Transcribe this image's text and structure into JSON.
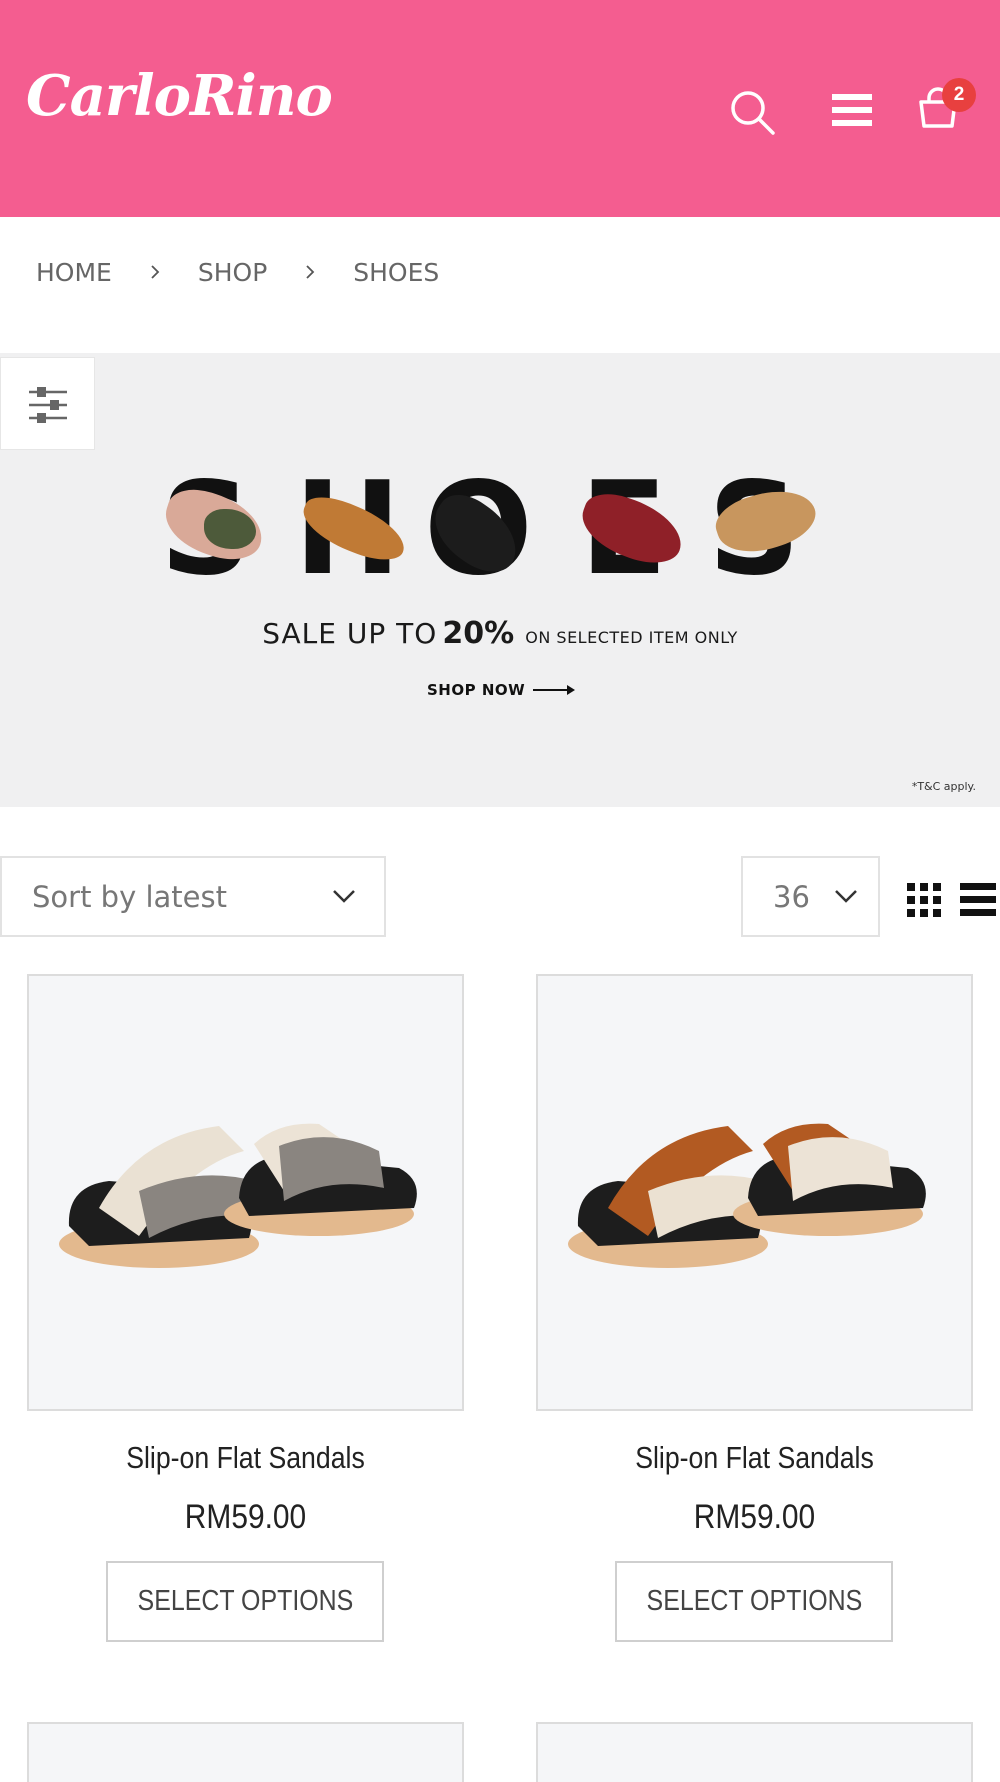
{
  "header": {
    "logo_text": "CarloRino",
    "cart_count": "2",
    "colors": {
      "header_bg": "#f45d90",
      "badge": "#e8403f"
    },
    "icons": [
      "search-icon",
      "menu-icon",
      "cart-icon"
    ]
  },
  "breadcrumb": [
    "HOME",
    "SHOP",
    "SHOES"
  ],
  "banner": {
    "title_letters": [
      "S",
      "H",
      "O",
      "E",
      "S"
    ],
    "sale_prefix": "SALE UP TO",
    "sale_percent": "20%",
    "sale_suffix": "ON SELECTED ITEM ONLY",
    "cta": "SHOP NOW",
    "tc": "*T&C apply."
  },
  "toolbar": {
    "sort_label": "Sort by latest",
    "per_page": "36",
    "icons": [
      "filter-icon",
      "grid-view-icon",
      "list-view-icon",
      "chevron-down-icon"
    ]
  },
  "products": [
    {
      "name": "Slip-on Flat Sandals",
      "price": "RM59.00",
      "button": "SELECT OPTIONS",
      "strap_color": "#8a8580"
    },
    {
      "name": "Slip-on Flat Sandals",
      "price": "RM59.00",
      "button": "SELECT OPTIONS",
      "strap_color": "#b25a22"
    }
  ]
}
